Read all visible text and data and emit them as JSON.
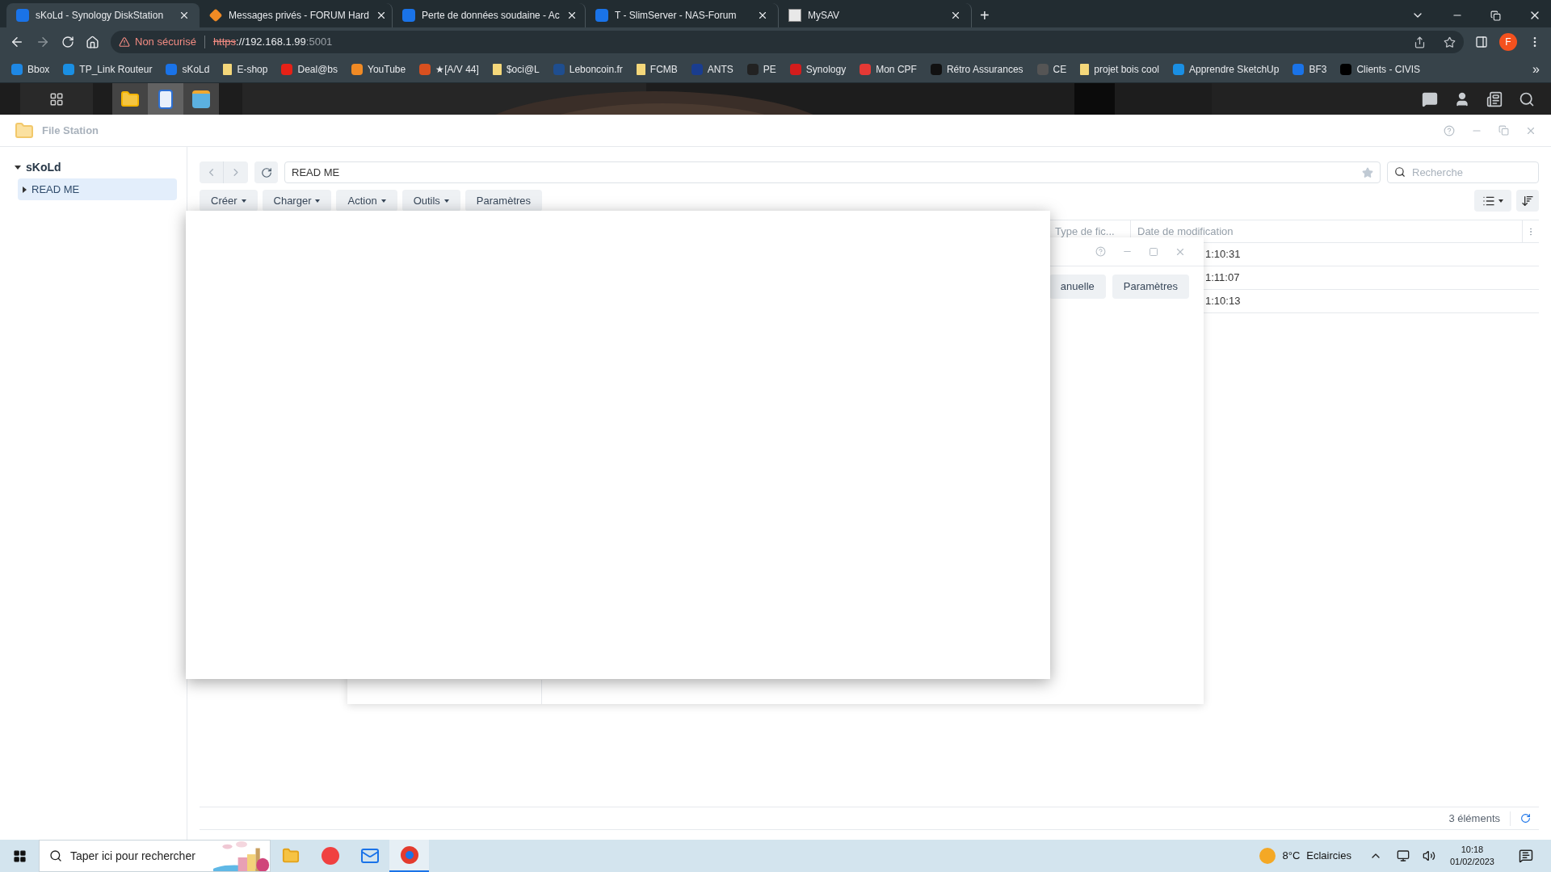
{
  "browser": {
    "tabs": [
      {
        "title": "sKoLd - Synology DiskStation",
        "selected": true
      },
      {
        "title": "Messages privés - FORUM Hard",
        "selected": false
      },
      {
        "title": "Perte de données soudaine - Ac",
        "selected": false
      },
      {
        "title": "T - SlimServer - NAS-Forum",
        "selected": false
      },
      {
        "title": "MySAV",
        "selected": false
      }
    ],
    "new_tab": "+",
    "address": {
      "security": "Non sécurisé",
      "scheme": "https",
      "host": "://192.168.1.99",
      "port": ":5001"
    },
    "profile": "F",
    "bookmarks": [
      {
        "label": "Bbox",
        "kind": "site"
      },
      {
        "label": "TP_Link Routeur",
        "kind": "site"
      },
      {
        "label": "sKoLd",
        "kind": "site"
      },
      {
        "label": "E-shop",
        "kind": "folder"
      },
      {
        "label": "Deal@bs",
        "kind": "site"
      },
      {
        "label": "YouTube",
        "kind": "site"
      },
      {
        "label": "★[A/V 44]",
        "kind": "site"
      },
      {
        "label": "$oci@L",
        "kind": "folder"
      },
      {
        "label": "Leboncoin.fr",
        "kind": "site"
      },
      {
        "label": "FCMB",
        "kind": "folder"
      },
      {
        "label": "ANTS",
        "kind": "site"
      },
      {
        "label": "PE",
        "kind": "site"
      },
      {
        "label": "Synology",
        "kind": "site"
      },
      {
        "label": "Mon CPF",
        "kind": "site"
      },
      {
        "label": "Rétro Assurances",
        "kind": "site"
      },
      {
        "label": "CE",
        "kind": "site"
      },
      {
        "label": "projet bois cool",
        "kind": "folder"
      },
      {
        "label": "Apprendre SketchUp",
        "kind": "site"
      },
      {
        "label": "BF3",
        "kind": "site"
      },
      {
        "label": "Clients - CIVIS",
        "kind": "site"
      }
    ],
    "bookmarks_overflow": "»"
  },
  "file_station": {
    "title": "File Station",
    "tree": [
      {
        "label": "sKoLd",
        "expanded": true,
        "selected": false,
        "children": [
          {
            "label": "READ ME",
            "expanded": false,
            "selected": true
          }
        ]
      }
    ],
    "path": "READ ME",
    "search": {
      "placeholder": "Recherche"
    },
    "toolbar": [
      {
        "label": "Créer",
        "dropdown": true
      },
      {
        "label": "Charger",
        "dropdown": true
      },
      {
        "label": "Action",
        "dropdown": true
      },
      {
        "label": "Outils",
        "dropdown": true
      },
      {
        "label": "Paramètres",
        "dropdown": false
      }
    ],
    "columns": [
      "Type de fic...",
      "Date de modification"
    ],
    "rows": [
      {
        "modified": "1:10:31"
      },
      {
        "modified": "1:11:07"
      },
      {
        "modified": "1:10:13"
      }
    ],
    "status": "3 éléments"
  },
  "dialog": {
    "buttons": [
      "anuelle",
      "Paramètres"
    ]
  },
  "taskbar": {
    "search": {
      "placeholder": "Taper ici pour rechercher"
    },
    "temperature": "8°C",
    "weather": "Eclaircies",
    "time": "10:18",
    "date": "01/02/2023"
  }
}
